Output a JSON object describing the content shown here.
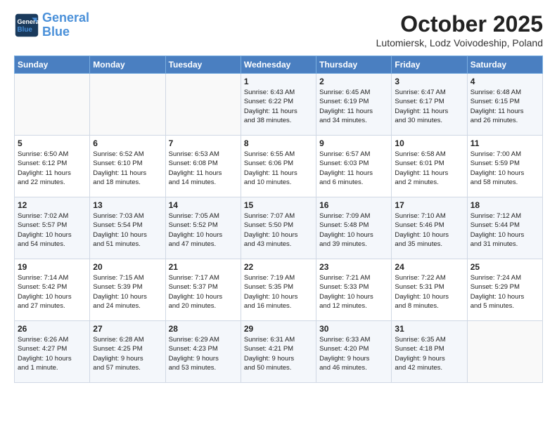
{
  "header": {
    "logo_line1": "General",
    "logo_line2": "Blue",
    "month": "October 2025",
    "location": "Lutomiersk, Lodz Voivodeship, Poland"
  },
  "days_of_week": [
    "Sunday",
    "Monday",
    "Tuesday",
    "Wednesday",
    "Thursday",
    "Friday",
    "Saturday"
  ],
  "weeks": [
    [
      {
        "day": "",
        "info": ""
      },
      {
        "day": "",
        "info": ""
      },
      {
        "day": "",
        "info": ""
      },
      {
        "day": "1",
        "info": "Sunrise: 6:43 AM\nSunset: 6:22 PM\nDaylight: 11 hours\nand 38 minutes."
      },
      {
        "day": "2",
        "info": "Sunrise: 6:45 AM\nSunset: 6:19 PM\nDaylight: 11 hours\nand 34 minutes."
      },
      {
        "day": "3",
        "info": "Sunrise: 6:47 AM\nSunset: 6:17 PM\nDaylight: 11 hours\nand 30 minutes."
      },
      {
        "day": "4",
        "info": "Sunrise: 6:48 AM\nSunset: 6:15 PM\nDaylight: 11 hours\nand 26 minutes."
      }
    ],
    [
      {
        "day": "5",
        "info": "Sunrise: 6:50 AM\nSunset: 6:12 PM\nDaylight: 11 hours\nand 22 minutes."
      },
      {
        "day": "6",
        "info": "Sunrise: 6:52 AM\nSunset: 6:10 PM\nDaylight: 11 hours\nand 18 minutes."
      },
      {
        "day": "7",
        "info": "Sunrise: 6:53 AM\nSunset: 6:08 PM\nDaylight: 11 hours\nand 14 minutes."
      },
      {
        "day": "8",
        "info": "Sunrise: 6:55 AM\nSunset: 6:06 PM\nDaylight: 11 hours\nand 10 minutes."
      },
      {
        "day": "9",
        "info": "Sunrise: 6:57 AM\nSunset: 6:03 PM\nDaylight: 11 hours\nand 6 minutes."
      },
      {
        "day": "10",
        "info": "Sunrise: 6:58 AM\nSunset: 6:01 PM\nDaylight: 11 hours\nand 2 minutes."
      },
      {
        "day": "11",
        "info": "Sunrise: 7:00 AM\nSunset: 5:59 PM\nDaylight: 10 hours\nand 58 minutes."
      }
    ],
    [
      {
        "day": "12",
        "info": "Sunrise: 7:02 AM\nSunset: 5:57 PM\nDaylight: 10 hours\nand 54 minutes."
      },
      {
        "day": "13",
        "info": "Sunrise: 7:03 AM\nSunset: 5:54 PM\nDaylight: 10 hours\nand 51 minutes."
      },
      {
        "day": "14",
        "info": "Sunrise: 7:05 AM\nSunset: 5:52 PM\nDaylight: 10 hours\nand 47 minutes."
      },
      {
        "day": "15",
        "info": "Sunrise: 7:07 AM\nSunset: 5:50 PM\nDaylight: 10 hours\nand 43 minutes."
      },
      {
        "day": "16",
        "info": "Sunrise: 7:09 AM\nSunset: 5:48 PM\nDaylight: 10 hours\nand 39 minutes."
      },
      {
        "day": "17",
        "info": "Sunrise: 7:10 AM\nSunset: 5:46 PM\nDaylight: 10 hours\nand 35 minutes."
      },
      {
        "day": "18",
        "info": "Sunrise: 7:12 AM\nSunset: 5:44 PM\nDaylight: 10 hours\nand 31 minutes."
      }
    ],
    [
      {
        "day": "19",
        "info": "Sunrise: 7:14 AM\nSunset: 5:42 PM\nDaylight: 10 hours\nand 27 minutes."
      },
      {
        "day": "20",
        "info": "Sunrise: 7:15 AM\nSunset: 5:39 PM\nDaylight: 10 hours\nand 24 minutes."
      },
      {
        "day": "21",
        "info": "Sunrise: 7:17 AM\nSunset: 5:37 PM\nDaylight: 10 hours\nand 20 minutes."
      },
      {
        "day": "22",
        "info": "Sunrise: 7:19 AM\nSunset: 5:35 PM\nDaylight: 10 hours\nand 16 minutes."
      },
      {
        "day": "23",
        "info": "Sunrise: 7:21 AM\nSunset: 5:33 PM\nDaylight: 10 hours\nand 12 minutes."
      },
      {
        "day": "24",
        "info": "Sunrise: 7:22 AM\nSunset: 5:31 PM\nDaylight: 10 hours\nand 8 minutes."
      },
      {
        "day": "25",
        "info": "Sunrise: 7:24 AM\nSunset: 5:29 PM\nDaylight: 10 hours\nand 5 minutes."
      }
    ],
    [
      {
        "day": "26",
        "info": "Sunrise: 6:26 AM\nSunset: 4:27 PM\nDaylight: 10 hours\nand 1 minute."
      },
      {
        "day": "27",
        "info": "Sunrise: 6:28 AM\nSunset: 4:25 PM\nDaylight: 9 hours\nand 57 minutes."
      },
      {
        "day": "28",
        "info": "Sunrise: 6:29 AM\nSunset: 4:23 PM\nDaylight: 9 hours\nand 53 minutes."
      },
      {
        "day": "29",
        "info": "Sunrise: 6:31 AM\nSunset: 4:21 PM\nDaylight: 9 hours\nand 50 minutes."
      },
      {
        "day": "30",
        "info": "Sunrise: 6:33 AM\nSunset: 4:20 PM\nDaylight: 9 hours\nand 46 minutes."
      },
      {
        "day": "31",
        "info": "Sunrise: 6:35 AM\nSunset: 4:18 PM\nDaylight: 9 hours\nand 42 minutes."
      },
      {
        "day": "",
        "info": ""
      }
    ]
  ]
}
